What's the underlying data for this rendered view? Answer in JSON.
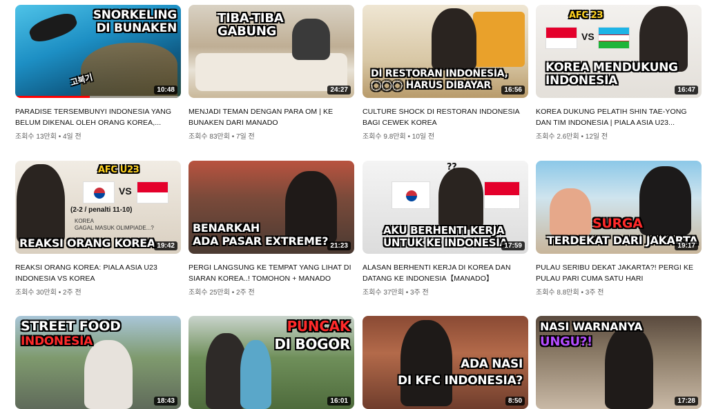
{
  "videos": [
    {
      "title": "PARADISE TERSEMBUNYI INDONESIA YANG BELUM DIKENAL OLEH ORANG KOREA,...",
      "views": "조회수 13만회",
      "age": "4일 전",
      "duration": "10:48",
      "caption": "SNORKELING\nDI BUNAKEN",
      "caption2": "고북기",
      "progress": 0.45
    },
    {
      "title": "MENJADI TEMAN DENGAN PARA OM | KE BUNAKEN DARI MANADO",
      "views": "조회수 83만회",
      "age": "7일 전",
      "duration": "24:27",
      "caption": "TIBA-TIBA\nGABUNG"
    },
    {
      "title": "CULTURE SHOCK DI RESTORAN INDONESIA BAGI CEWEK KOREA",
      "views": "조회수 9.8만회",
      "age": "10일 전",
      "duration": "16:56",
      "caption": "DI RESTORAN INDONESIA,\n◯◯◯ HARUS DIBAYAR"
    },
    {
      "title": "KOREA DUKUNG PELATIH SHIN TAE-YONG DAN TIM INDONESIA | PIALA ASIA U23...",
      "views": "조회수 2.6만회",
      "age": "12일 전",
      "duration": "16:47",
      "caption": "KOREA MENDUKUNG\nINDONESIA",
      "caption2": "AFC 23",
      "vs": "VS"
    },
    {
      "title": "REAKSI ORANG KOREA: PIALA ASIA U23 INDONESIA VS KOREA",
      "views": "조회수 30만회",
      "age": "2주 전",
      "duration": "19:42",
      "caption": "REAKSI ORANG KOREA",
      "caption2": "AFC U23",
      "vs": "VS",
      "caption3": "(2-2 / penalti 11-10)",
      "caption4": "KOREA\nGAGAL MASUK OLIMPIADE...?"
    },
    {
      "title": "PERGI LANGSUNG KE TEMPAT YANG LIHAT DI SIARAN KOREA..! TOMOHON + MANADO",
      "views": "조회수 25만회",
      "age": "2주 전",
      "duration": "21:23",
      "caption": "BENARKAH\nADA PASAR EXTREME?"
    },
    {
      "title": "ALASAN BERHENTI KERJA DI KOREA DAN DATANG KE INDONESIA【MANADO】",
      "views": "조회수 37만회",
      "age": "3주 전",
      "duration": "17:59",
      "caption": "AKU BERHENTI KERJA\nUNTUK KE INDONESIA",
      "caption2": "??"
    },
    {
      "title": "PULAU SERIBU DEKAT JAKARTA?! PERGI KE PULAU PARI CUMA SATU HARI",
      "views": "조회수 8.8만회",
      "age": "3주 전",
      "duration": "19:17",
      "caption": "SURGA",
      "caption2": "TERDEKAT DARI JAKARTA"
    },
    {
      "title": "",
      "views": "",
      "age": "",
      "duration": "18:43",
      "caption": "STREET FOOD",
      "caption2": "INDONESIA"
    },
    {
      "title": "",
      "views": "",
      "age": "",
      "duration": "16:01",
      "caption": "PUNCAK",
      "caption2": "DI BOGOR"
    },
    {
      "title": "",
      "views": "",
      "age": "",
      "duration": "8:50",
      "caption": "ADA NASI\nDI KFC INDONESIA?"
    },
    {
      "title": "",
      "views": "",
      "age": "",
      "duration": "17:28",
      "caption": "NASI WARNANYA",
      "caption2": "UNGU?!"
    }
  ],
  "colors": {
    "progress": "#ff0000",
    "meta": "#606060"
  },
  "separator": "•"
}
